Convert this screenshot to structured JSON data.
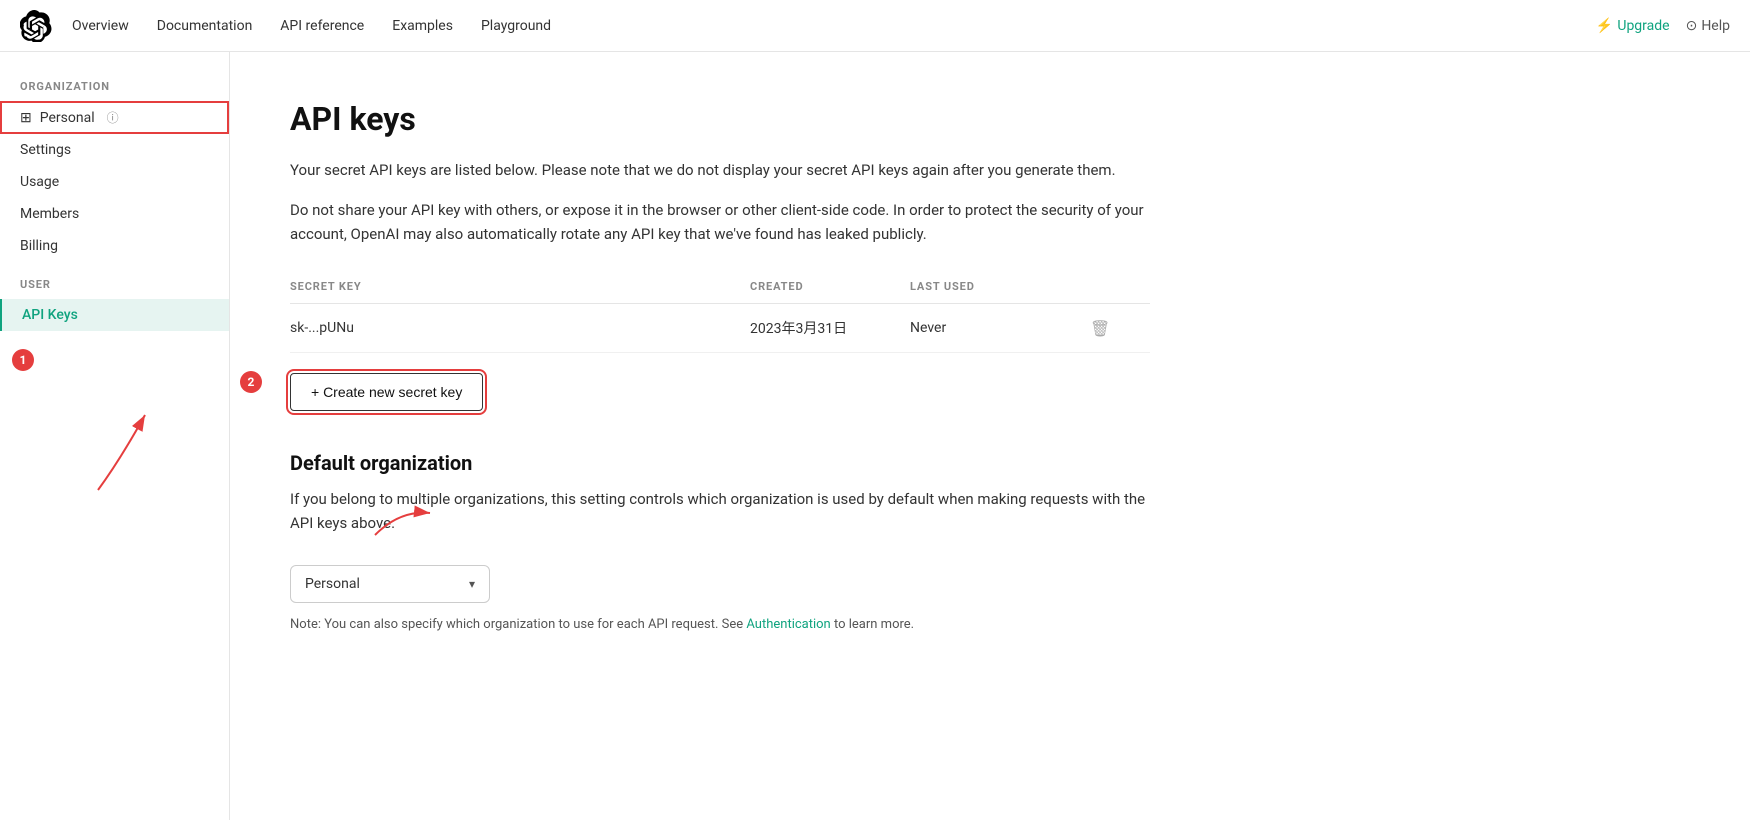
{
  "topnav": {
    "links": [
      {
        "label": "Overview",
        "id": "overview"
      },
      {
        "label": "Documentation",
        "id": "documentation"
      },
      {
        "label": "API reference",
        "id": "api-reference"
      },
      {
        "label": "Examples",
        "id": "examples"
      },
      {
        "label": "Playground",
        "id": "playground"
      }
    ],
    "upgrade_label": "Upgrade",
    "help_label": "Help"
  },
  "sidebar": {
    "org_section_label": "ORGANIZATION",
    "org_items": [
      {
        "label": "Personal",
        "id": "personal",
        "icon": "grid"
      },
      {
        "label": "Settings",
        "id": "settings"
      },
      {
        "label": "Usage",
        "id": "usage"
      },
      {
        "label": "Members",
        "id": "members"
      },
      {
        "label": "Billing",
        "id": "billing"
      }
    ],
    "user_section_label": "USER",
    "user_items": [
      {
        "label": "API Keys",
        "id": "api-keys",
        "active": true
      }
    ]
  },
  "main": {
    "page_title": "API keys",
    "description1": "Your secret API keys are listed below. Please note that we do not display your secret API keys again after you generate them.",
    "description2": "Do not share your API key with others, or expose it in the browser or other client-side code. In order to protect the security of your account, OpenAI may also automatically rotate any API key that we've found has leaked publicly.",
    "table": {
      "headers": [
        "SECRET KEY",
        "CREATED",
        "LAST USED",
        ""
      ],
      "rows": [
        {
          "key": "sk-...pUNu",
          "created": "2023年3月31日",
          "last_used": "Never"
        }
      ]
    },
    "create_btn_label": "+ Create new secret key",
    "default_org_title": "Default organization",
    "default_org_desc": "If you belong to multiple organizations, this setting controls which organization is used by default when making requests with the API keys above.",
    "org_select_value": "Personal",
    "note_text": "Note: You can also specify which organization to use for each API request. See ",
    "note_link": "Authentication",
    "note_text2": " to learn more."
  },
  "annotations": {
    "circle1_label": "1",
    "circle2_label": "2"
  }
}
